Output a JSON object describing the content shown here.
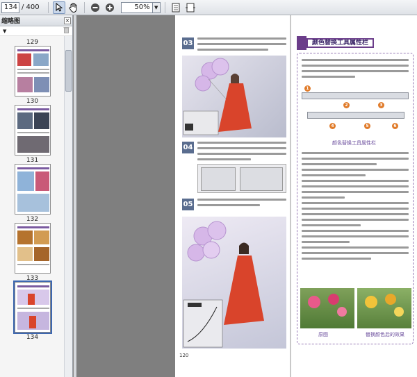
{
  "toolbar": {
    "page_current": "134",
    "page_total": "/ 400",
    "zoom_value": "50%",
    "icons": [
      "select-arrow-icon",
      "hand-tool-icon",
      "zoom-out-icon",
      "zoom-in-icon",
      "fit-page-icon",
      "fit-width-icon"
    ]
  },
  "panel": {
    "title": "缩略图",
    "thumbnails": [
      {
        "label": "129"
      },
      {
        "label": "130"
      },
      {
        "label": "131"
      },
      {
        "label": "132"
      },
      {
        "label": "133"
      },
      {
        "label": "134"
      }
    ]
  },
  "document": {
    "steps": [
      "03",
      "04",
      "05"
    ],
    "section_title": "颜色替换工具属性栏",
    "caption_toolbar": "颜色替换工具属性栏",
    "caption_before": "原图",
    "caption_after": "替换颜色后的效果",
    "left_page_number": "120",
    "colors": {
      "accent_purple": "#6b3d8a",
      "step_blue": "#5a6d8f",
      "dress_red": "#d9442b",
      "balloon_lilac": "#d6b7e8"
    }
  }
}
